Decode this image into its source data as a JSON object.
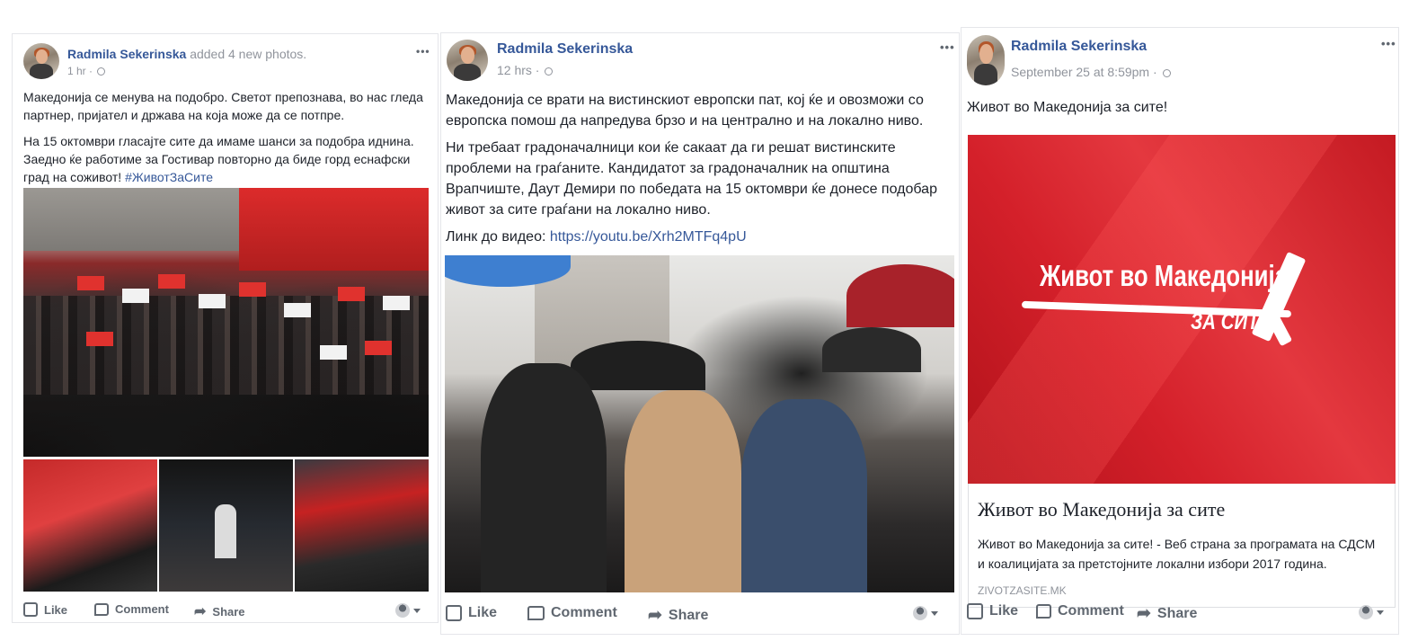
{
  "posts": [
    {
      "author": "Radmila Sekerinska",
      "author_extra": "added 4 new photos.",
      "time": "1 hr",
      "paragraphs": [
        "Македонија се менува на подобро. Светот препознава, во нас гледа партнер, пријател и држава на која може да се потпре.",
        "На 15 октомври гласајте сите да имаме шанси за подобра иднина. Заедно ќе работиме за Гостивар повторно да биде горд еснафски град на соживот! "
      ],
      "hashtag": "#ЖивотЗаСите",
      "actions": {
        "like": "Like",
        "comment": "Comment",
        "share": "Share"
      }
    },
    {
      "author": "Radmila Sekerinska",
      "time": "12 hrs",
      "paragraphs": [
        "Македонија се врати на вистинскиот европски пат, кој ќе и овозможи со европска помош да напредува брзо и на централно и на локално ниво.",
        "Ни требаат градоначалници кои ќе сакаат да ги решат вистинските проблеми на граѓаните. Кандидатот за градоначалник на општина Врапчиште, Даут Демири по победата на 15 октомври ќе донесе подобар живот за сите граѓани на локално ниво."
      ],
      "link_prefix": "Линк до видео: ",
      "link": "https://youtu.be/Xrh2MTFq4pU",
      "actions": {
        "like": "Like",
        "comment": "Comment",
        "share": "Share"
      }
    },
    {
      "author": "Radmila Sekerinska",
      "time": "September 25 at 8:59pm",
      "text": "Живот во Македонија за сите!",
      "card": {
        "image_title_line1": "Живот во Македонија",
        "image_title_line2": "ЗА СИТЕ",
        "title": "Живот во Македонија за сите",
        "description": "Живот во Македонија за сите! - Веб страна за програмата на СДСМ и коалицијата за претстојните локални избори 2017 година.",
        "domain": "ZIVOTZASITE.MK"
      },
      "actions": {
        "like": "Like",
        "comment": "Comment",
        "share": "Share"
      }
    }
  ],
  "more_glyph": "•••",
  "colors": {
    "link": "#365899",
    "muted": "#90949c",
    "brand_red": "#d4202a"
  }
}
